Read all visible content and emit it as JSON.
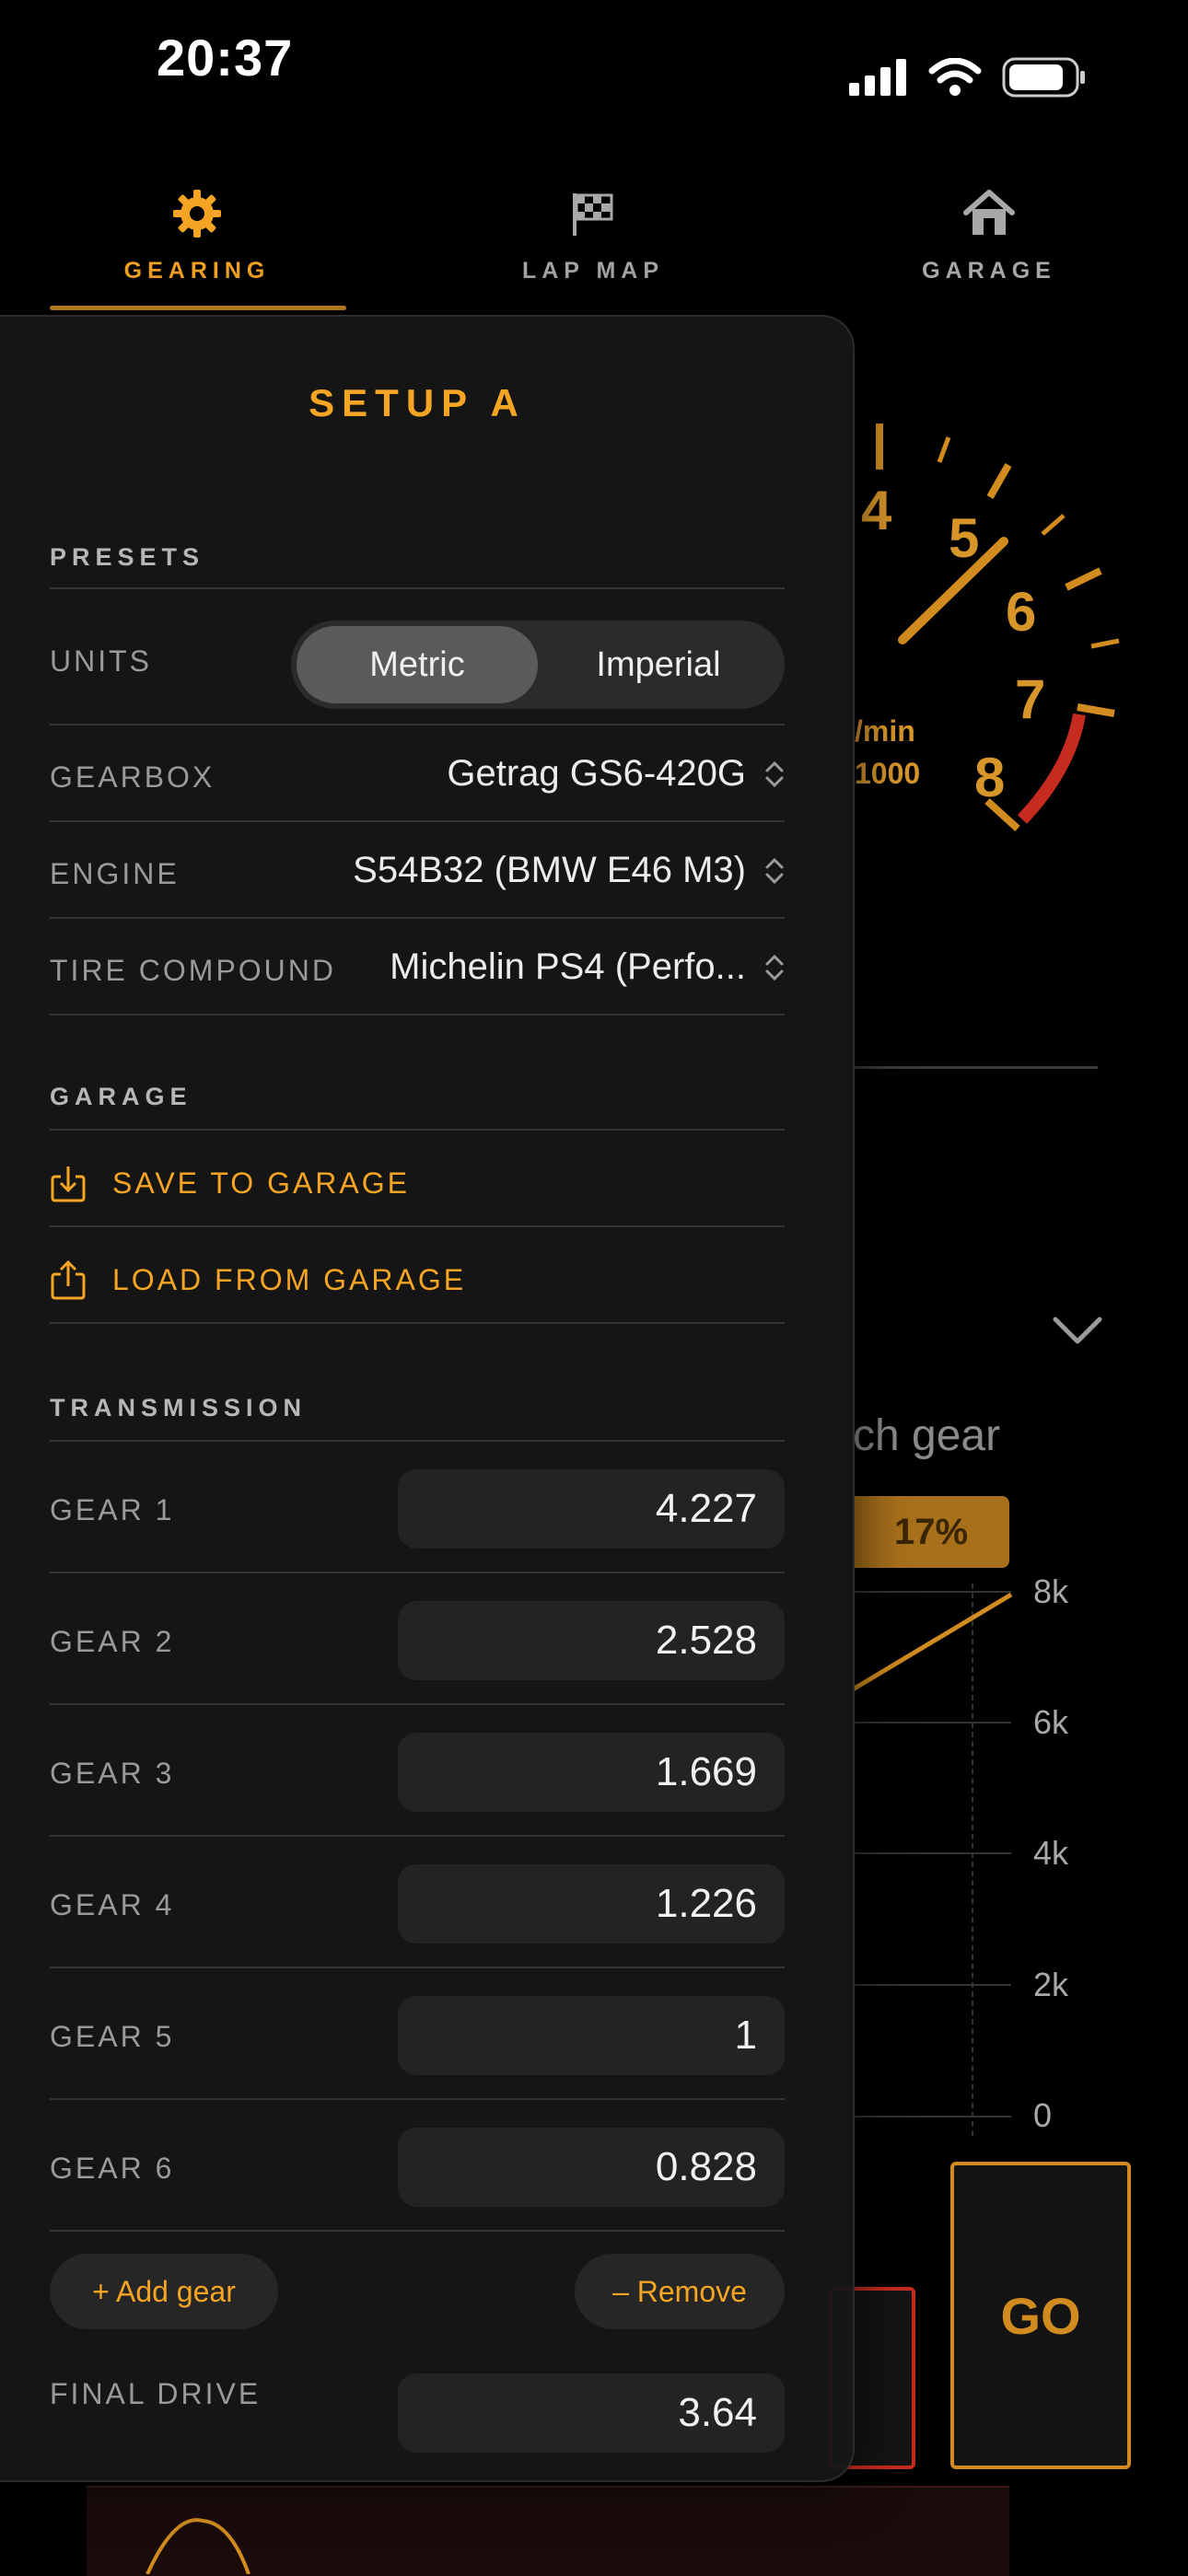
{
  "status": {
    "time": "20:37"
  },
  "tabs": [
    {
      "label": "GEARING",
      "icon": "gear-icon",
      "active": true
    },
    {
      "label": "LAP MAP",
      "icon": "checkered-flag-icon",
      "active": false
    },
    {
      "label": "GARAGE",
      "icon": "house-icon",
      "active": false
    }
  ],
  "accent_color": "#f5a523",
  "background": {
    "gauge_numbers": [
      "4",
      "5",
      "6",
      "7",
      "8"
    ],
    "gauge_unit": "/min",
    "gauge_multiplier": "1000",
    "chart_title_fragment": "ch gear",
    "percent_badge": "17%",
    "y_ticks": [
      "8k",
      "6k",
      "4k",
      "2k",
      "0"
    ],
    "go_label": "GO"
  },
  "panel": {
    "title": "SETUP A",
    "presets": {
      "heading": "PRESETS",
      "units_label": "UNITS",
      "units_options": [
        "Metric",
        "Imperial"
      ],
      "units_selected": "Metric",
      "gearbox_label": "GEARBOX",
      "gearbox_value": "Getrag GS6-420G",
      "engine_label": "ENGINE",
      "engine_value": "S54B32 (BMW E46 M3)",
      "tire_label": "TIRE COMPOUND",
      "tire_value": "Michelin PS4 (Perfo..."
    },
    "garage": {
      "heading": "GARAGE",
      "save_label": "SAVE TO GARAGE",
      "load_label": "LOAD FROM GARAGE"
    },
    "transmission": {
      "heading": "TRANSMISSION",
      "gears": [
        {
          "label": "GEAR 1",
          "value": "4.227"
        },
        {
          "label": "GEAR 2",
          "value": "2.528"
        },
        {
          "label": "GEAR 3",
          "value": "1.669"
        },
        {
          "label": "GEAR 4",
          "value": "1.226"
        },
        {
          "label": "GEAR 5",
          "value": "1"
        },
        {
          "label": "GEAR 6",
          "value": "0.828"
        }
      ],
      "add_gear_label": "+ Add gear",
      "remove_label": "– Remove",
      "final_drive_label": "FINAL DRIVE",
      "final_drive_value": "3.64"
    }
  }
}
